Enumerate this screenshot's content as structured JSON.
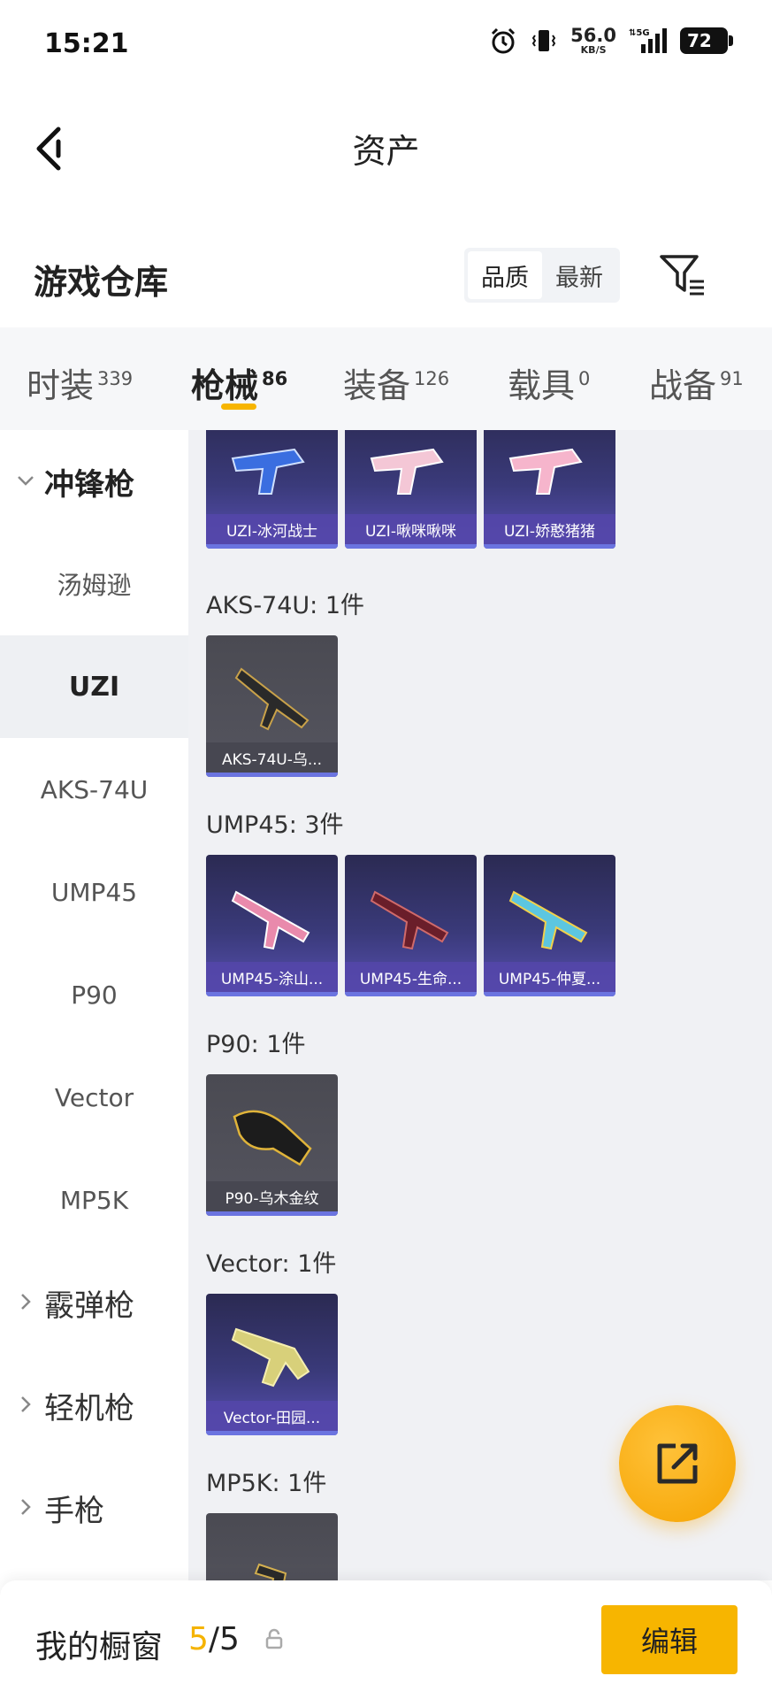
{
  "status_bar": {
    "time": "15:21",
    "net_speed": "56.0",
    "net_unit": "KB/S",
    "network": "5G",
    "battery": "72",
    "icons": [
      "alarm-icon",
      "vibrate-icon",
      "signal-icon",
      "battery-icon"
    ]
  },
  "header": {
    "title": "资产"
  },
  "warehouse": {
    "title": "游戏仓库",
    "sort_options": [
      "品质",
      "最新"
    ],
    "sort_selected": "品质"
  },
  "tabs": [
    {
      "label": "时装",
      "count": "339"
    },
    {
      "label": "枪械",
      "count": "86"
    },
    {
      "label": "装备",
      "count": "126"
    },
    {
      "label": "载具",
      "count": "0"
    },
    {
      "label": "战备",
      "count": "91"
    }
  ],
  "sidebar": {
    "items": [
      {
        "label": "冲锋枪"
      },
      {
        "label": "汤姆逊"
      },
      {
        "label": "UZI"
      },
      {
        "label": "AKS-74U"
      },
      {
        "label": "UMP45"
      },
      {
        "label": "P90"
      },
      {
        "label": "Vector"
      },
      {
        "label": "MP5K"
      },
      {
        "label": "霰弹枪"
      },
      {
        "label": "轻机枪"
      },
      {
        "label": "手枪"
      }
    ]
  },
  "content": {
    "uzi_cards": [
      "UZI-冰河战士",
      "UZI-啾咪啾咪",
      "UZI-娇憨猪猪"
    ],
    "aks_label": "AKS-74U: 1件",
    "aks_cards": [
      "AKS-74U-乌..."
    ],
    "ump_label": "UMP45: 3件",
    "ump_cards": [
      "UMP45-涂山...",
      "UMP45-生命...",
      "UMP45-仲夏..."
    ],
    "p90_label": "P90: 1件",
    "p90_cards": [
      "P90-乌木金纹"
    ],
    "vector_label": "Vector: 1件",
    "vector_cards": [
      "Vector-田园..."
    ],
    "mp5k_label": "MP5K: 1件"
  },
  "bottom_bar": {
    "showcase_label": "我的橱窗",
    "current": "5",
    "separator": "/",
    "total": "5",
    "edit_label": "编辑"
  },
  "colors": {
    "accent": "#f7b500",
    "card_purple": "#3a3a7a",
    "card_grey": "#55555f",
    "content_bg": "#f0f1f4"
  }
}
